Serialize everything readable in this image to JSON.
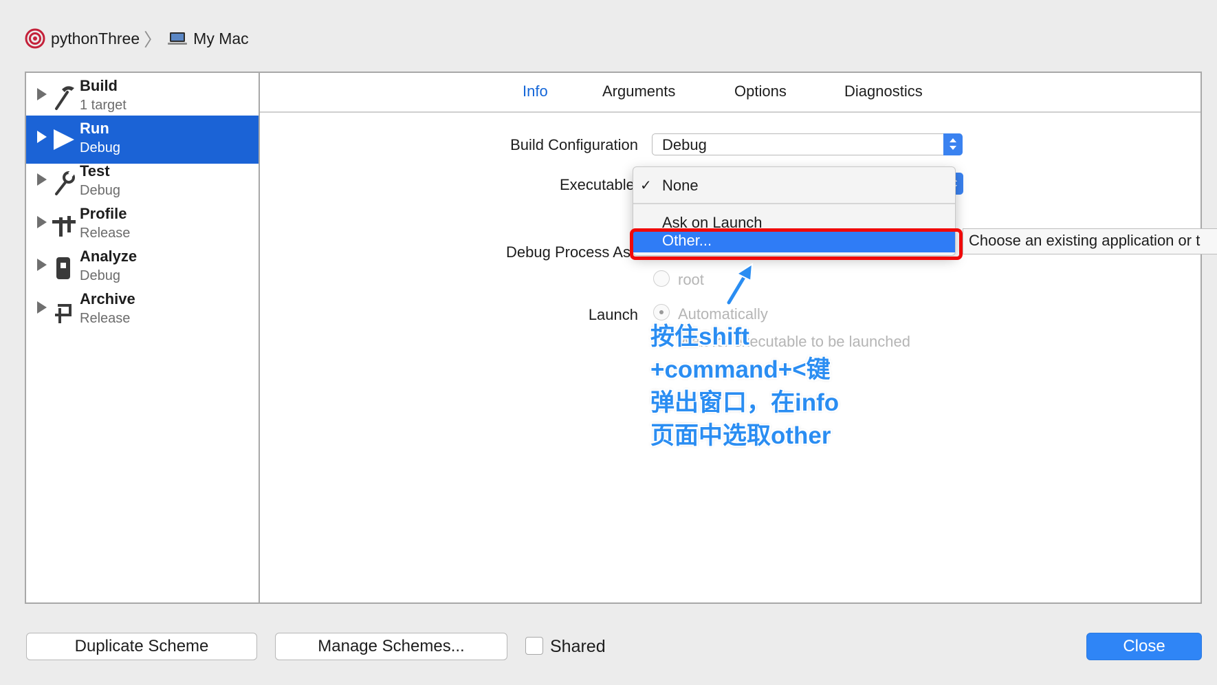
{
  "breadcrumb": {
    "scheme": "pythonThree",
    "destination": "My Mac"
  },
  "sidebar": {
    "items": [
      {
        "title": "Build",
        "subtitle": "1 target"
      },
      {
        "title": "Run",
        "subtitle": "Debug",
        "selected": true
      },
      {
        "title": "Test",
        "subtitle": "Debug"
      },
      {
        "title": "Profile",
        "subtitle": "Release"
      },
      {
        "title": "Analyze",
        "subtitle": "Debug"
      },
      {
        "title": "Archive",
        "subtitle": "Release"
      }
    ]
  },
  "tabs": [
    {
      "label": "Info",
      "active": true
    },
    {
      "label": "Arguments"
    },
    {
      "label": "Options"
    },
    {
      "label": "Diagnostics"
    }
  ],
  "form": {
    "build_config_label": "Build Configuration",
    "build_config_value": "Debug",
    "executable_label": "Executable",
    "debug_process_label": "Debug Process As",
    "root_label": "root",
    "launch_label": "Launch",
    "launch_automatically": "Automatically",
    "launch_wait_hint": "Wait for executable to be launched"
  },
  "menu": {
    "items": [
      "None",
      "Ask on Launch",
      "Other..."
    ],
    "checked": "None",
    "highlighted": "Other..."
  },
  "tooltip": "Choose an existing application or t",
  "annotation": {
    "lines": [
      "按住shift",
      "+command+<键",
      "弹出窗口，在info",
      "页面中选取other"
    ]
  },
  "footer": {
    "duplicate": "Duplicate Scheme",
    "manage": "Manage Schemes...",
    "shared": "Shared",
    "close": "Close"
  },
  "colors": {
    "selection": "#1b63d6",
    "accent": "#2f85f6",
    "highlight_border": "#f00a0a",
    "annotation": "#2a8df2"
  }
}
